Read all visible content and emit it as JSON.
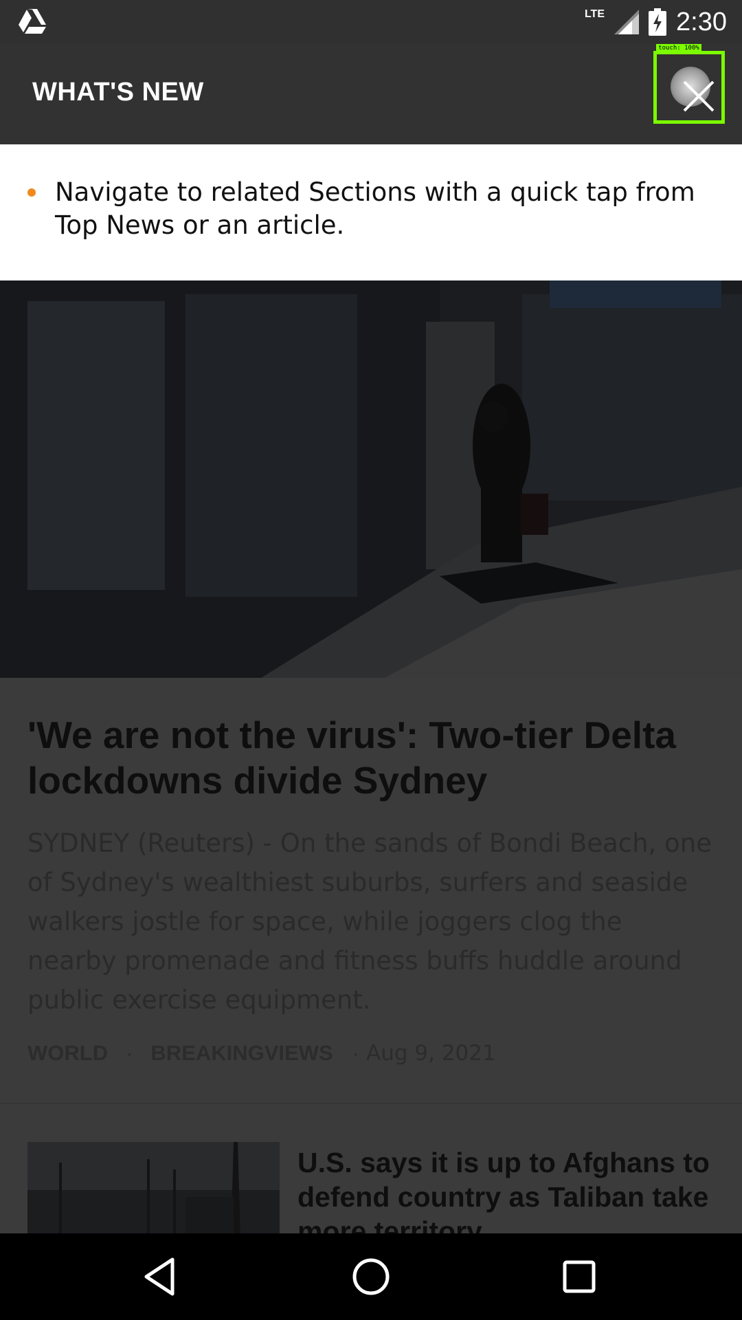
{
  "status_bar": {
    "network": "LTE",
    "time": "2:30",
    "icons": [
      "drive-icon",
      "signal-icon",
      "battery-charging-icon"
    ]
  },
  "dialog": {
    "title": "WHAT'S NEW",
    "close_icon": "close-icon",
    "touch_indicator": "touch: 100%",
    "items": [
      {
        "text": "Navigate to related Sections with a quick tap from Top News or an article."
      }
    ]
  },
  "feed": {
    "lead_article": {
      "title": "'We are not the virus': Two-tier Delta lockdowns divide Sydney",
      "summary": "SYDNEY (Reuters) -     On the sands of Bondi Beach, one of Sydney's wealthiest suburbs, surfers and seaside walkers jostle for space, while joggers clog the nearby promenade and fitness buffs huddle around public exercise equipment.",
      "tags": [
        "WORLD",
        "BREAKINGVIEWS"
      ],
      "date": "Aug 9, 2021",
      "separator": "·"
    },
    "second_article": {
      "title": "U.S. says it is up to Afghans to defend country as Taliban take more territory"
    }
  },
  "nav_bar": {
    "buttons": [
      "back-icon",
      "home-icon",
      "recents-icon"
    ]
  },
  "colors": {
    "accent_bullet": "#f08a1c",
    "header_bg": "#323232",
    "touch_highlight": "#7cfc00"
  }
}
